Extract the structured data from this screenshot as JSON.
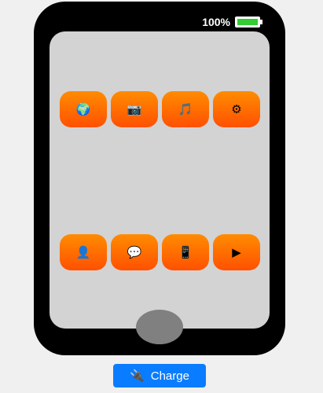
{
  "status": {
    "battery_text": "100%",
    "battery_level": 1.0,
    "battery_color": "#33cc33"
  },
  "apps": [
    {
      "name": "globe-icon",
      "glyph": "🌍"
    },
    {
      "name": "camera-icon",
      "glyph": "📷"
    },
    {
      "name": "music-icon",
      "glyph": "🎵"
    },
    {
      "name": "settings-gear-icon",
      "glyph": "⚙"
    },
    {
      "name": "user-icon",
      "glyph": "👤"
    },
    {
      "name": "chat-bubble-icon",
      "glyph": "💬"
    },
    {
      "name": "phone-device-icon",
      "glyph": "📱"
    },
    {
      "name": "video-play-icon",
      "glyph": "▶"
    }
  ],
  "charge_button": {
    "label": "Charge",
    "icon": "plug-icon",
    "glyph": "🔌"
  },
  "colors": {
    "app_top": "#ff8c00",
    "app_bottom": "#ff5000",
    "button": "#0a7cff"
  }
}
